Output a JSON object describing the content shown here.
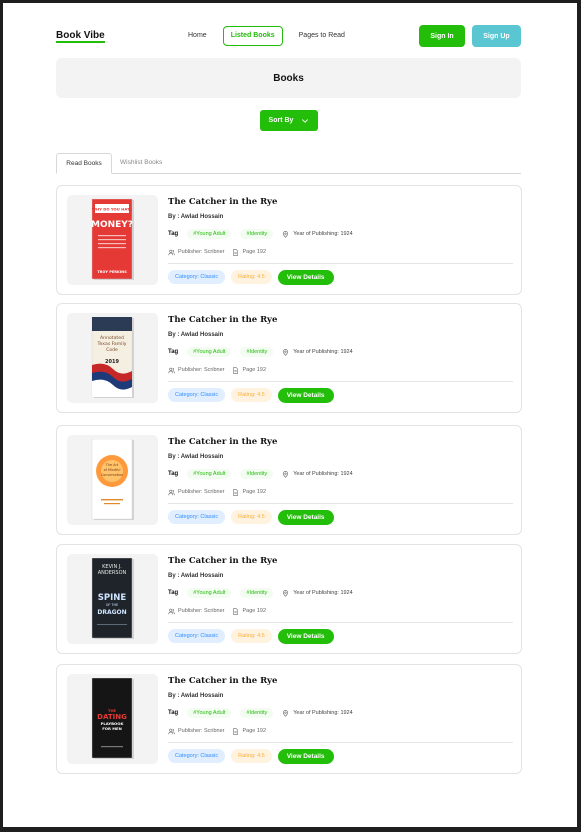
{
  "nav": {
    "logo": "Book Vibe",
    "links": [
      "Home",
      "Listed Books",
      "Pages to Read"
    ],
    "sign_in": "Sign In",
    "sign_up": "Sign Up"
  },
  "hero": {
    "title": "Books"
  },
  "sort": {
    "label": "Sort By"
  },
  "tabs": {
    "read": "Read Books",
    "wishlist": "Wishlist Books"
  },
  "books": [
    {
      "title": "The Catcher in the Rye",
      "author": "By : Awlad Hossain",
      "tag_label": "Tag",
      "tags": [
        "#Young Adult",
        "#Identity"
      ],
      "year": "Year of Publishing: 1924",
      "publisher": "Publisher: Scribner",
      "pages": "Page 192",
      "category": "Category: Classic",
      "rating": "Rating: 4.5",
      "view": "View Details",
      "cover": {
        "bg": "#e53935",
        "lines": [
          "WHY DO YOU HATE",
          "MONEY?"
        ],
        "author": "TROY PERKINS"
      }
    },
    {
      "title": "The Catcher in the Rye",
      "author": "By : Awlad Hossain",
      "tag_label": "Tag",
      "tags": [
        "#Young Adult",
        "#Identity"
      ],
      "year": "Year of Publishing: 1924",
      "publisher": "Publisher: Scribner",
      "pages": "Page 192",
      "category": "Category: Classic",
      "rating": "Rating: 4.5",
      "view": "View Details",
      "cover": {
        "bg": "#f5efe2",
        "lines": [
          "Annotated",
          "Texas Family",
          "Code"
        ],
        "author": "2019"
      }
    },
    {
      "title": "The Catcher in the Rye",
      "author": "By : Awlad Hossain",
      "tag_label": "Tag",
      "tags": [
        "#Young Adult",
        "#Identity"
      ],
      "year": "Year of Publishing: 1924",
      "publisher": "Publisher: Scribner",
      "pages": "Page 192",
      "category": "Category: Classic",
      "rating": "Rating: 4.5",
      "view": "View Details",
      "cover": {
        "bg": "#ffffff",
        "lines": [
          "The Art",
          "of Mindful",
          "Conversation"
        ],
        "author": ""
      }
    },
    {
      "title": "The Catcher in the Rye",
      "author": "By : Awlad Hossain",
      "tag_label": "Tag",
      "tags": [
        "#Young Adult",
        "#Identity"
      ],
      "year": "Year of Publishing: 1924",
      "publisher": "Publisher: Scribner",
      "pages": "Page 192",
      "category": "Category: Classic",
      "rating": "Rating: 4.5",
      "view": "View Details",
      "cover": {
        "bg": "#1e2429",
        "lines": [
          "KEVIN J.",
          "ANDERSON",
          "SPINE",
          "OF THE",
          "DRAGON"
        ],
        "author": ""
      }
    },
    {
      "title": "The Catcher in the Rye",
      "author": "By : Awlad Hossain",
      "tag_label": "Tag",
      "tags": [
        "#Young Adult",
        "#Identity"
      ],
      "year": "Year of Publishing: 1924",
      "publisher": "Publisher: Scribner",
      "pages": "Page 192",
      "category": "Category: Classic",
      "rating": "Rating: 4.5",
      "view": "View Details",
      "cover": {
        "bg": "#151515",
        "lines": [
          "THE",
          "DATING",
          "PLAYBOOK",
          "FOR MEN"
        ],
        "author": ""
      }
    }
  ],
  "colors": {
    "primary": "#23BE0A",
    "secondary": "#59C6D2",
    "category": "#328EFF",
    "rating": "#FFAC33"
  }
}
